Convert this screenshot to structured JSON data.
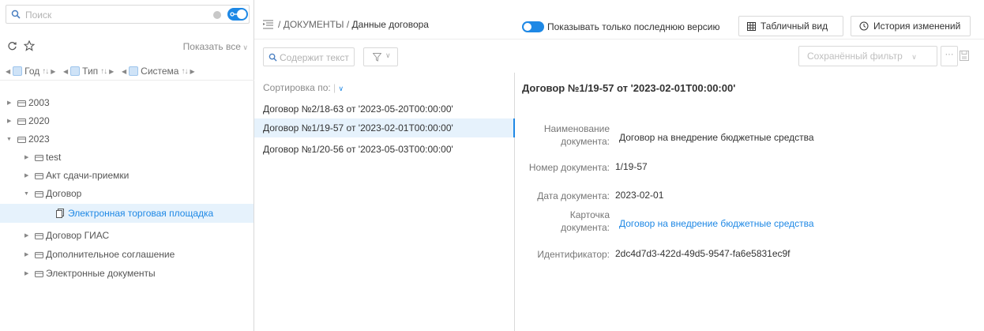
{
  "left": {
    "search": {
      "placeholder": "Поиск"
    },
    "toolbar": {
      "show_all": "Показать все"
    },
    "sort_chips": [
      {
        "label": "Год"
      },
      {
        "label": "Тип"
      },
      {
        "label": "Система"
      }
    ],
    "tree": [
      {
        "label": "2003"
      },
      {
        "label": "2020"
      },
      {
        "label": "2023"
      },
      {
        "label": "test"
      },
      {
        "label": "Акт сдачи-приемки"
      },
      {
        "label": "Договор"
      },
      {
        "label": "Электронная торговая площадка"
      },
      {
        "label": "Договор ГИАС"
      },
      {
        "label": "Дополнительное соглашение"
      },
      {
        "label": "Электронные документы"
      }
    ]
  },
  "header": {
    "breadcrumb_root": "ДОКУМЕНТЫ",
    "breadcrumb_current": "Данные договора",
    "separator": "/",
    "toggle_label": "Показывать только последнюю версию",
    "table_view": "Табличный вид",
    "history": "История изменений"
  },
  "middle": {
    "search_placeholder": "Содержит текст",
    "sort_by": "Сортировка по:",
    "docs": [
      {
        "title": "Договор №2/18-63 от '2023-05-20T00:00:00'"
      },
      {
        "title": "Договор №1/19-57 от '2023-02-01T00:00:00'"
      },
      {
        "title": "Договор №1/20-56 от '2023-05-03T00:00:00'"
      }
    ]
  },
  "right": {
    "saved_filter": "Сохранённый фильтр",
    "more": "···",
    "title": "Договор №1/19-57 от '2023-02-01T00:00:00'",
    "fields": {
      "name_label_1": "Наименование",
      "name_label_2": "документа:",
      "name_value": "Договор на внедрение  бюджетные средства",
      "number_label": "Номер документа:",
      "number_value": "1/19-57",
      "date_label": "Дата документа:",
      "date_value": "2023-02-01",
      "card_label_1": "Карточка",
      "card_label_2": "документа:",
      "card_value": "Договор на внедрение бюджетные средства",
      "id_label": "Идентификатор:",
      "id_value": "2dc4d7d3-422d-49d5-9547-fa6e5831ec9f"
    },
    "colors": {
      "accent": "#1e88e5",
      "selection": "#e6f2fc"
    }
  }
}
